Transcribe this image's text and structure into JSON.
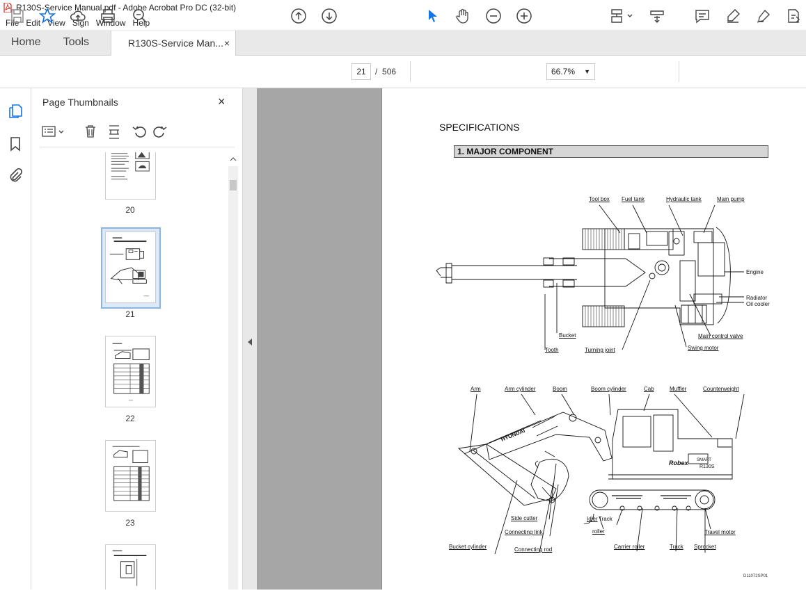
{
  "window": {
    "title": "R130S-Service Manual.pdf - Adobe Acrobat Pro DC (32-bit)"
  },
  "menu": [
    "File",
    "Edit",
    "View",
    "Sign",
    "Window",
    "Help"
  ],
  "tabs": {
    "home": "Home",
    "tools": "Tools",
    "document": "R130S-Service Man...",
    "close": "×"
  },
  "toolbar": {
    "current_page": "21",
    "page_separator": "/",
    "total_pages": "506",
    "zoom": "66.7%"
  },
  "panel": {
    "title": "Page Thumbnails",
    "close": "×",
    "thumbnails": [
      {
        "label": "20"
      },
      {
        "label": "21",
        "selected": true
      },
      {
        "label": "22"
      },
      {
        "label": "23"
      }
    ]
  },
  "document": {
    "heading": "SPECIFICATIONS",
    "section_title": "1. MAJOR COMPONENT",
    "top_view_labels": {
      "tool_box": "Tool box",
      "fuel_tank": "Fuel tank",
      "hydraulic_tank": "Hydraulic tank",
      "main_pump": "Main pump",
      "engine": "Engine",
      "radiator": "Radiator",
      "oil_cooler": "Oil cooler",
      "bucket": "Bucket",
      "main_control_valve": "Main control valve",
      "tooth": "Tooth",
      "turning_joint": "Turning joint",
      "swing_motor": "Swing motor"
    },
    "side_view_labels": {
      "arm": "Arm",
      "arm_cylinder": "Arm cylinder",
      "boom": "Boom",
      "boom_cylinder": "Boom cylinder",
      "cab": "Cab",
      "muffler": "Muffler",
      "counterweight": "Counterweight",
      "side_cutter": "Side cutter",
      "idler": "Idler",
      "track_roller_1": "Track",
      "track_roller_2": "roller",
      "connecting_link": "Connecting link",
      "travel_motor": "Travel motor",
      "bucket_cylinder": "Bucket cylinder",
      "carrier_roller": "Carrier roller",
      "track": "Track",
      "sprocket": "Sprocket",
      "connecting_rod": "Connecting rod"
    },
    "machine_markings": {
      "boom_brand": "HYUNDAI",
      "body_brand": "Robex",
      "model": "R130S",
      "smart": "SMART"
    },
    "figure_code": "D11072SP01"
  }
}
